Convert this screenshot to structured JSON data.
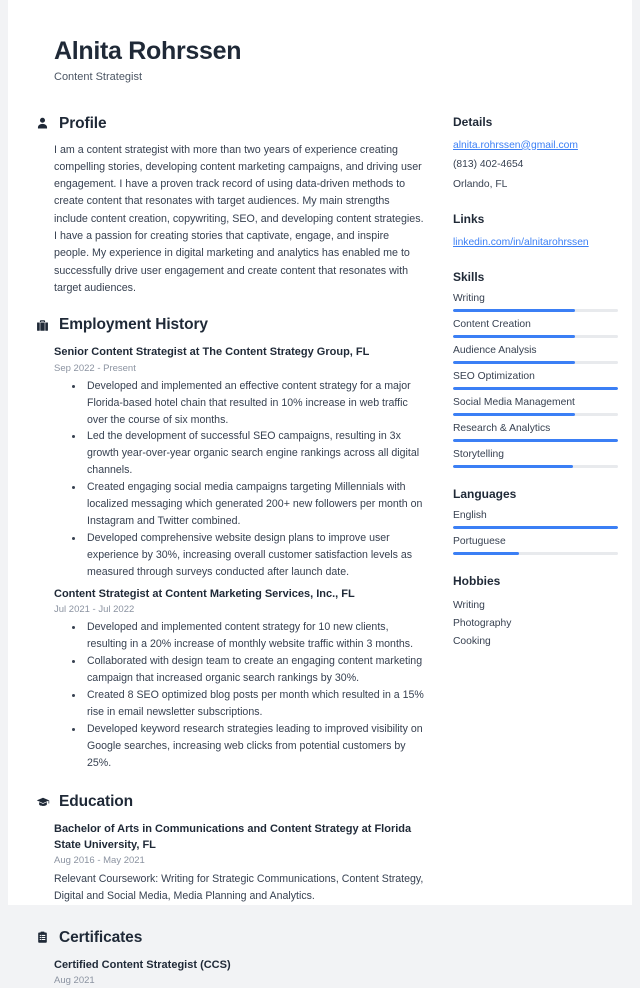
{
  "header": {
    "name": "Alnita Rohrssen",
    "job_title": "Content Strategist"
  },
  "accent_color": "#3b7ff5",
  "sections": {
    "profile": {
      "heading": "Profile",
      "icon": "person-icon",
      "text": "I am a content strategist with more than two years of experience creating compelling stories, developing content marketing campaigns, and driving user engagement. I have a proven track record of using data-driven methods to create content that resonates with target audiences. My main strengths include content creation, copywriting, SEO, and developing content strategies. I have a passion for creating stories that captivate, engage, and inspire people. My experience in digital marketing and analytics has enabled me to successfully drive user engagement and create content that resonates with target audiences."
    },
    "employment": {
      "heading": "Employment History",
      "icon": "briefcase-icon",
      "jobs": [
        {
          "title": "Senior Content Strategist at The Content Strategy Group, FL",
          "date": "Sep 2022 - Present",
          "bullets": [
            "Developed and implemented an effective content strategy for a major Florida-based hotel chain that resulted in 10% increase in web traffic over the course of six months.",
            "Led the development of successful SEO campaigns, resulting in 3x growth year-over-year organic search engine rankings across all digital channels.",
            "Created engaging social media campaigns targeting Millennials with localized messaging which generated 200+ new followers per month on Instagram and Twitter combined.",
            "Developed comprehensive website design plans to improve user experience by 30%, increasing overall customer satisfaction levels as measured through surveys conducted after launch date."
          ]
        },
        {
          "title": "Content Strategist at Content Marketing Services, Inc., FL",
          "date": "Jul 2021 - Jul 2022",
          "bullets": [
            "Developed and implemented content strategy for 10 new clients, resulting in a 20% increase of monthly website traffic within 3 months.",
            "Collaborated with design team to create an engaging content marketing campaign that increased organic search rankings by 30%.",
            "Created 8 SEO optimized blog posts per month which resulted in a 15% rise in email newsletter subscriptions.",
            "Developed keyword research strategies leading to improved visibility on Google searches, increasing web clicks from potential customers by 25%."
          ]
        }
      ]
    },
    "education": {
      "heading": "Education",
      "icon": "graduation-cap-icon",
      "entries": [
        {
          "title": "Bachelor of Arts in Communications and Content Strategy at Florida State University, FL",
          "date": "Aug 2016 - May 2021",
          "description": "Relevant Coursework: Writing for Strategic Communications, Content Strategy, Digital and Social Media, Media Planning and Analytics."
        }
      ]
    },
    "certificates": {
      "heading": "Certificates",
      "icon": "clipboard-icon",
      "entries": [
        {
          "title": "Certified Content Strategist (CCS)",
          "date": "Aug 2021"
        }
      ]
    }
  },
  "sidebar": {
    "details": {
      "heading": "Details",
      "email": "alnita.rohrssen@gmail.com",
      "phone": "(813) 402-4654",
      "location": "Orlando, FL"
    },
    "links": {
      "heading": "Links",
      "items": [
        {
          "label": "linkedin.com/in/alnitarohrssen"
        }
      ]
    },
    "skills": {
      "heading": "Skills",
      "items": [
        {
          "label": "Writing",
          "level": 74
        },
        {
          "label": "Content Creation",
          "level": 74
        },
        {
          "label": "Audience Analysis",
          "level": 74
        },
        {
          "label": "SEO Optimization",
          "level": 100
        },
        {
          "label": "Social Media Management",
          "level": 74
        },
        {
          "label": "Research & Analytics",
          "level": 100
        },
        {
          "label": "Storytelling",
          "level": 73
        }
      ]
    },
    "languages": {
      "heading": "Languages",
      "items": [
        {
          "label": "English",
          "level": 100
        },
        {
          "label": "Portuguese",
          "level": 40
        }
      ]
    },
    "hobbies": {
      "heading": "Hobbies",
      "items": [
        "Writing",
        "Photography",
        "Cooking"
      ]
    }
  }
}
